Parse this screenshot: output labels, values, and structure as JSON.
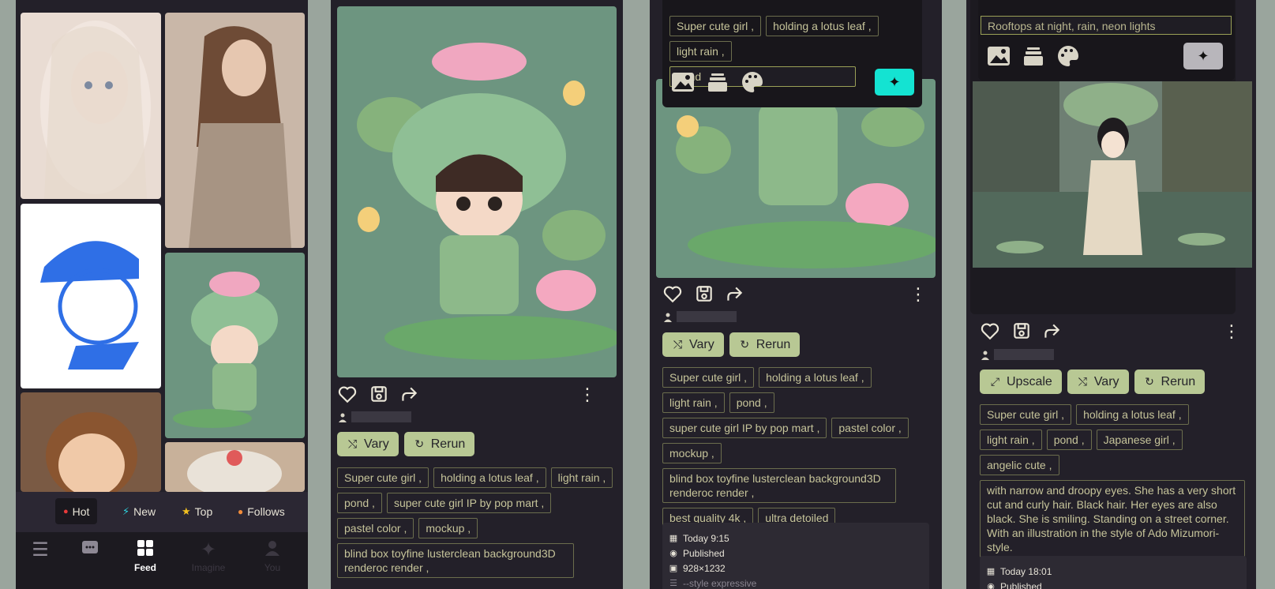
{
  "colors": {
    "background": "#9aa59d",
    "panel": "#232029",
    "accent_button": "#b8c894",
    "generate_active": "#14e3d2",
    "generate_disabled": "#b8b6bb",
    "tag_border": "#6b6d4d",
    "hot_icon": "#e83a3a",
    "new_icon": "#2fd5e0",
    "top_icon": "#f2c020",
    "follows_icon": "#f28c3a"
  },
  "feed": {
    "filters": [
      {
        "label": "Hot",
        "icon": "flame-icon"
      },
      {
        "label": "New",
        "icon": "bolt-icon"
      },
      {
        "label": "Top",
        "icon": "star-icon"
      },
      {
        "label": "Follows",
        "icon": "person-icon"
      }
    ],
    "nav": [
      {
        "label": "",
        "icon": "menu-icon"
      },
      {
        "label": "",
        "icon": "chat-icon"
      },
      {
        "label": "Feed",
        "icon": "grid-icon"
      },
      {
        "label": "Imagine",
        "icon": "magic-wand-icon"
      },
      {
        "label": "You",
        "icon": "person-icon"
      }
    ]
  },
  "detail2": {
    "buttons": {
      "vary": "Vary",
      "rerun": "Rerun"
    },
    "tags": [
      "Super cute girl ,",
      "holding a lotus leaf ,",
      "light rain ,",
      "pond ,",
      "super cute girl IP by pop mart ,",
      "pastel color ,",
      "mockup ,",
      "blind box toyfine lusterclean background3D renderoc render ,"
    ]
  },
  "detail3": {
    "prompt_tags": [
      "Super cute girl ,",
      "holding a lotus leaf ,",
      "light rain ,"
    ],
    "prompt_input": "pond",
    "buttons": {
      "vary": "Vary",
      "rerun": "Rerun"
    },
    "tags": [
      "Super cute girl ,",
      "holding a lotus leaf ,",
      "light rain ,",
      "pond ,",
      "super cute girl IP by pop mart ,",
      "pastel color ,",
      "mockup ,",
      "blind box toyfine lusterclean background3D renderoc render ,",
      "best quality 4k ,",
      "ultra detoiled"
    ],
    "meta": {
      "time": "Today 9:15",
      "status": "Published",
      "size": "928×1232",
      "style": "--style expressive"
    }
  },
  "detail4": {
    "prompt_input": "Rooftops at night, rain, neon lights",
    "buttons": {
      "upscale": "Upscale",
      "vary": "Vary",
      "rerun": "Rerun"
    },
    "tags": [
      "Super cute girl ,",
      "holding a lotus leaf ,",
      "light rain ,",
      "pond ,",
      "Japanese girl ,",
      "angelic cute ,"
    ],
    "long_text": "with narrow and droopy eyes. She has a very short cut and curly hair. Black hair. Her eyes are also black. She is smiling. Standing on a street corner. With an illustration in the style of Ado Mizumori-style.",
    "meta": {
      "time": "Today 18:01",
      "status": "Published"
    }
  }
}
